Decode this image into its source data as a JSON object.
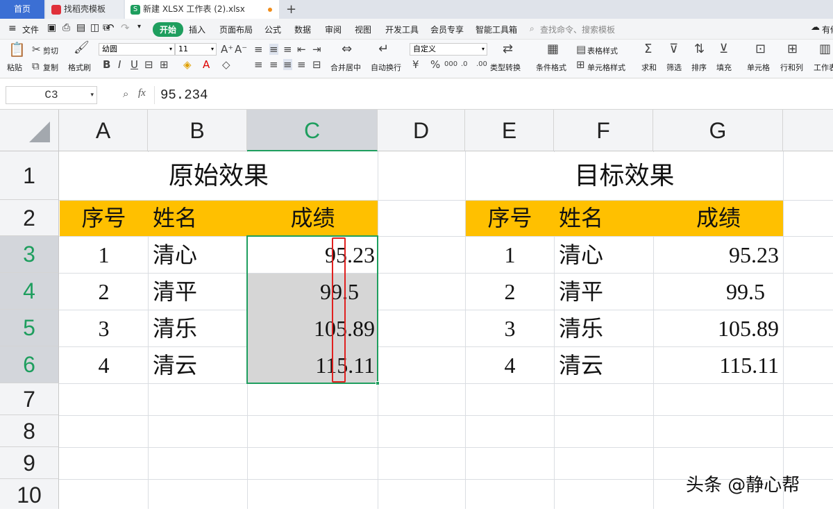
{
  "tabs": [
    {
      "label": "首页"
    },
    {
      "label": "找稻壳模板"
    },
    {
      "label": "新建 XLSX 工作表 (2).xlsx"
    }
  ],
  "menu": {
    "file": "文件",
    "start": "开始",
    "items": [
      "插入",
      "页面布局",
      "公式",
      "数据",
      "审阅",
      "视图",
      "开发工具",
      "会员专享",
      "智能工具箱"
    ],
    "search_placeholder": "查找命令、搜索模板",
    "right_label": "有修"
  },
  "ribbon": {
    "paste": "粘贴",
    "cut": "剪切",
    "copy": "复制",
    "format_painter": "格式刷",
    "font_name": "幼圆",
    "font_size": "11",
    "merge": "合并居中",
    "wrap": "自动换行",
    "number_format": "自定义",
    "type_convert": "类型转换",
    "cond_format": "条件格式",
    "table_style": "表格样式",
    "cell_style": "单元格样式",
    "sum": "求和",
    "filter": "筛选",
    "sort": "排序",
    "fill": "填充",
    "cell": "单元格",
    "row_col": "行和列",
    "worksheet": "工作表"
  },
  "formula_bar": {
    "cell_ref": "C3",
    "fx": "fx",
    "value": "95.234"
  },
  "columns": [
    "A",
    "B",
    "C",
    "D",
    "E",
    "F",
    "G"
  ],
  "rows": [
    "1",
    "2",
    "3",
    "4",
    "5",
    "6",
    "7",
    "8",
    "9",
    "10"
  ],
  "left_table": {
    "title": "原始效果",
    "headers": [
      "序号",
      "姓名",
      "成绩"
    ],
    "rows": [
      {
        "idx": "1",
        "name": "清心",
        "score": "95.23"
      },
      {
        "idx": "2",
        "name": "清平",
        "score": "99.5"
      },
      {
        "idx": "3",
        "name": "清乐",
        "score": "105.89"
      },
      {
        "idx": "4",
        "name": "清云",
        "score": "115.11"
      }
    ]
  },
  "right_table": {
    "title": "目标效果",
    "headers": [
      "序号",
      "姓名",
      "成绩"
    ],
    "rows": [
      {
        "idx": "1",
        "name": "清心",
        "score": "95.23"
      },
      {
        "idx": "2",
        "name": "清平",
        "score": "99.5"
      },
      {
        "idx": "3",
        "name": "清乐",
        "score": "105.89"
      },
      {
        "idx": "4",
        "name": "清云",
        "score": "115.11"
      }
    ]
  },
  "watermark": "头条 @静心帮",
  "colors": {
    "header_fill": "#ffc000",
    "selection": "#1e9e5e",
    "highlight_box": "#e0201f"
  }
}
